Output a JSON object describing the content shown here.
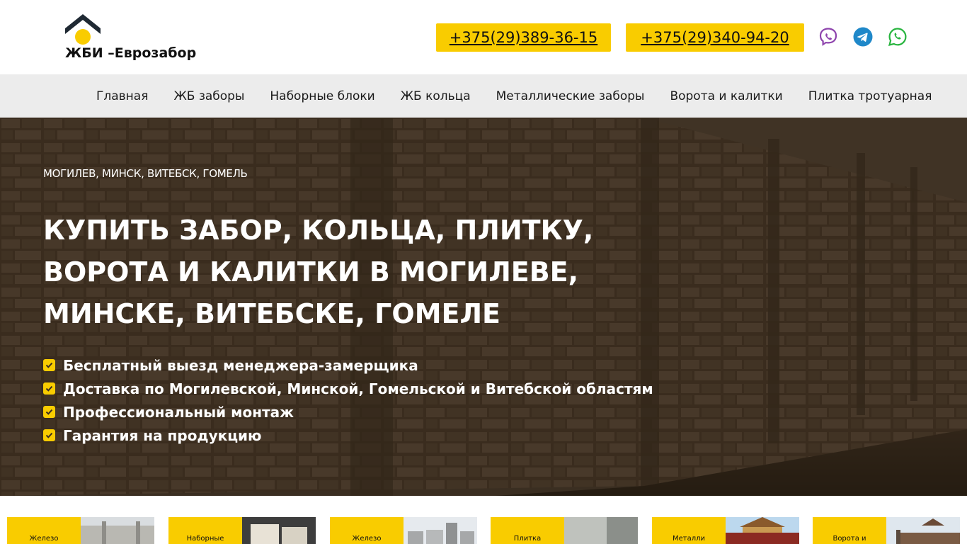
{
  "header": {
    "logo_text": "ЖБИ –Еврозабор",
    "phone_1": "+375(29)389-36-15",
    "phone_2": "+375(29)340-94-20",
    "messengers": [
      "viber-icon",
      "telegram-icon",
      "whatsapp-icon"
    ],
    "accent_color": "#f9cc00"
  },
  "nav": {
    "items": [
      {
        "label": "Главная"
      },
      {
        "label": "ЖБ заборы"
      },
      {
        "label": "Наборные блоки"
      },
      {
        "label": "ЖБ кольца"
      },
      {
        "label": "Металлические заборы"
      },
      {
        "label": "Ворота и калитки"
      },
      {
        "label": "Плитка тротуарная"
      }
    ]
  },
  "hero": {
    "cities": "МОГИЛЕВ, МИНСК, ВИТЕБСК, ГОМЕЛЬ",
    "title": "КУПИТЬ ЗАБОР, КОЛЬЦА, ПЛИТКУ, ВОРОТА И КАЛИТКИ В МОГИЛЕВЕ, МИНСКЕ, ВИТЕБСКЕ, ГОМЕЛЕ",
    "benefits": [
      "Бесплатный выезд менеджера-замерщика",
      "Доставка по Могилевской, Минской, Гомельской и Витебской областям",
      "Профессиональный монтаж",
      "Гарантия на продукцию"
    ]
  },
  "cards": [
    {
      "label": "Железо"
    },
    {
      "label": "Наборные"
    },
    {
      "label": "Железо"
    },
    {
      "label": "Плитка"
    },
    {
      "label": "Металли"
    },
    {
      "label": "Ворота и"
    }
  ]
}
